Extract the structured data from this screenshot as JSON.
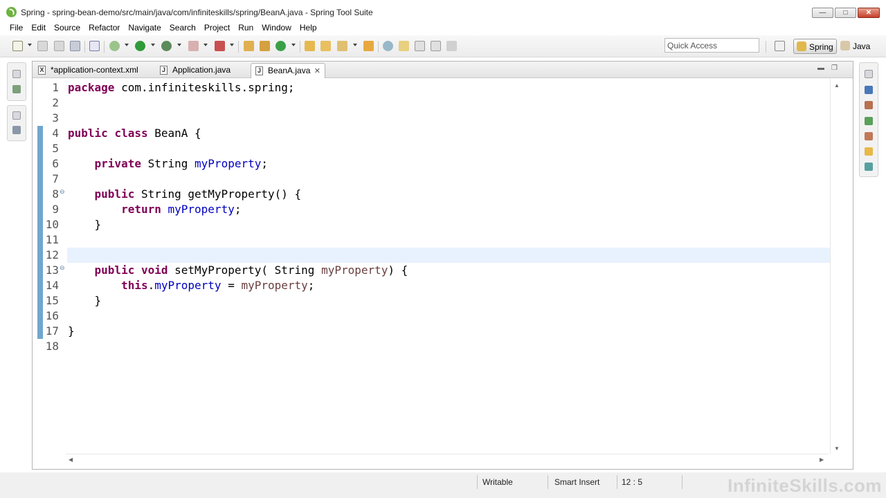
{
  "window": {
    "title": "Spring - spring-bean-demo/src/main/java/com/infiniteskills/spring/BeanA.java - Spring Tool Suite",
    "minimize": "—",
    "maximize": "□",
    "close": "✕"
  },
  "menu": [
    "File",
    "Edit",
    "Source",
    "Refactor",
    "Navigate",
    "Search",
    "Project",
    "Run",
    "Window",
    "Help"
  ],
  "toolbar": {
    "quick_access_placeholder": "Quick Access",
    "perspectives": [
      {
        "label": "Spring",
        "active": true
      },
      {
        "label": "Java",
        "active": false
      }
    ]
  },
  "tabs": [
    {
      "label": "*application-context.xml",
      "icon": "xml-file-icon",
      "active": false
    },
    {
      "label": "Application.java",
      "icon": "java-file-icon",
      "active": false
    },
    {
      "label": "BeanA.java",
      "icon": "java-file-icon",
      "active": true
    }
  ],
  "editor": {
    "line_numbers": [
      "1",
      "2",
      "3",
      "4",
      "5",
      "6",
      "7",
      "8",
      "9",
      "10",
      "11",
      "12",
      "13",
      "14",
      "15",
      "16",
      "17",
      "18"
    ],
    "current_line": 12
  },
  "status": {
    "writable": "Writable",
    "insert_mode": "Smart Insert",
    "position": "12 : 5"
  },
  "watermark": "InfiniteSkills.com",
  "colors": {
    "keyword": "#7f0055",
    "field": "#0000c0",
    "parameter": "#6a3e3e",
    "current_line": "#e8f2fe",
    "change_bar": "#6fa7cf"
  }
}
